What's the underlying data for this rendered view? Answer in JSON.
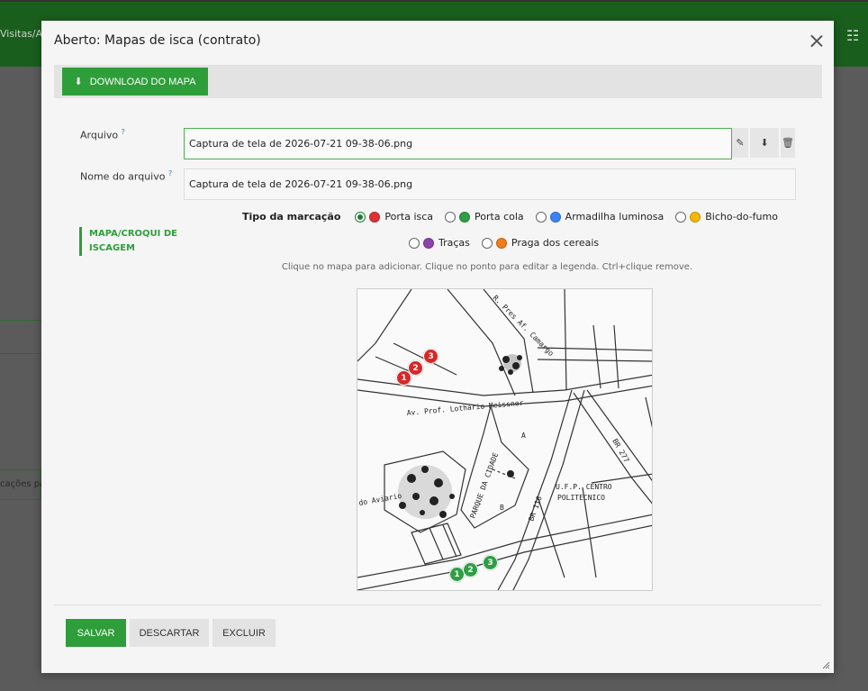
{
  "background": {
    "breadcrumb": "Visitas/A",
    "side_text": "cações pa"
  },
  "modal": {
    "title": "Aberto: Mapas de isca (contrato)",
    "download_button": "DOWNLOAD DO MAPA",
    "fields": {
      "arquivo_label": "Arquivo",
      "arquivo_value": "Captura de tela de 2026-07-21 09-38-06.png",
      "nome_label": "Nome do arquivo",
      "nome_value": "Captura de tela de 2026-07-21 09-38-06.png",
      "help_mark": "?"
    },
    "section_label": "MAPA/CROQUI DE ISCAGEM",
    "marking": {
      "title": "Tipo da marcação",
      "selected": "Porta isca",
      "options": [
        {
          "label": "Porta isca",
          "color": "#e03131"
        },
        {
          "label": "Porta cola",
          "color": "#2f9e44"
        },
        {
          "label": "Armadilha luminosa",
          "color": "#3b82f6"
        },
        {
          "label": "Bicho-do-fumo",
          "color": "#f5b800"
        },
        {
          "label": "Traças",
          "color": "#8e44ad"
        },
        {
          "label": "Praga dos cereais",
          "color": "#f07c1a"
        }
      ]
    },
    "hint": "Clique no mapa para adicionar. Clique no ponto para editar a legenda. Ctrl+clique remove.",
    "map": {
      "street_labels": [
        "Av. Prof. Lothario Meissner",
        "PARQUE DA CIDADE",
        "U.F.P. CENTRO",
        "POLITECNICO",
        "BR 116",
        "BR 277",
        "R. Pres Af. Camargo",
        "do Aviario",
        "A",
        "B"
      ],
      "markers": [
        {
          "n": "1",
          "color": "#d62828"
        },
        {
          "n": "2",
          "color": "#d62828"
        },
        {
          "n": "3",
          "color": "#d62828"
        },
        {
          "n": "1",
          "color": "#2f9e44"
        },
        {
          "n": "2",
          "color": "#2f9e44"
        },
        {
          "n": "3",
          "color": "#2f9e44"
        }
      ]
    },
    "footer": {
      "save": "SALVAR",
      "discard": "DESCARTAR",
      "delete": "EXCLUIR"
    }
  }
}
